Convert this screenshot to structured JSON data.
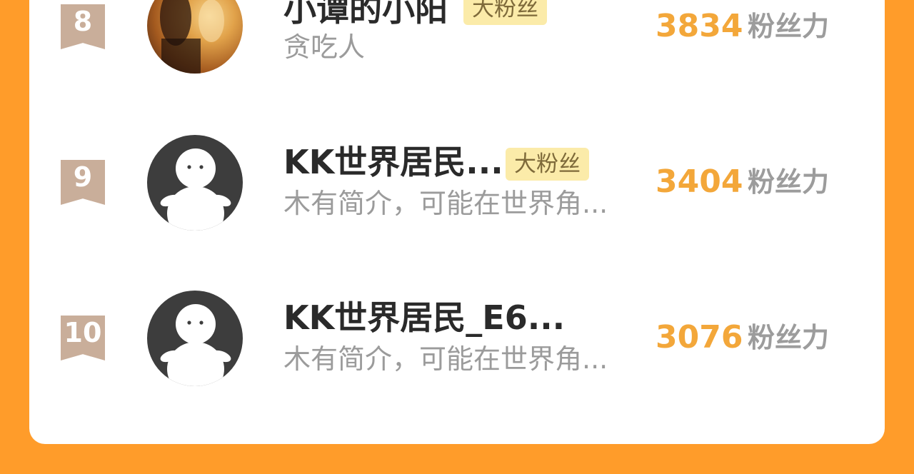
{
  "colors": {
    "page_bg": "#FF9C2A",
    "card_bg": "#FFFFFF",
    "score": "#F3A73A",
    "badge_bg": "#FBEBA9"
  },
  "rows": [
    {
      "rank": "8",
      "name": "小谭的小阳",
      "badge": "大粉丝",
      "desc": "贪吃人",
      "score": "3834",
      "unit": "粉丝力",
      "avatar": "photo-avatar"
    },
    {
      "rank": "9",
      "name": "KK世界居民...",
      "badge": "大粉丝",
      "desc": "木有简介，可能在世界角...",
      "score": "3404",
      "unit": "粉丝力",
      "avatar": "default-avatar"
    },
    {
      "rank": "10",
      "name": "KK世界居民_E6...",
      "desc": "木有简介，可能在世界角...",
      "score": "3076",
      "unit": "粉丝力",
      "avatar": "default-avatar"
    }
  ]
}
